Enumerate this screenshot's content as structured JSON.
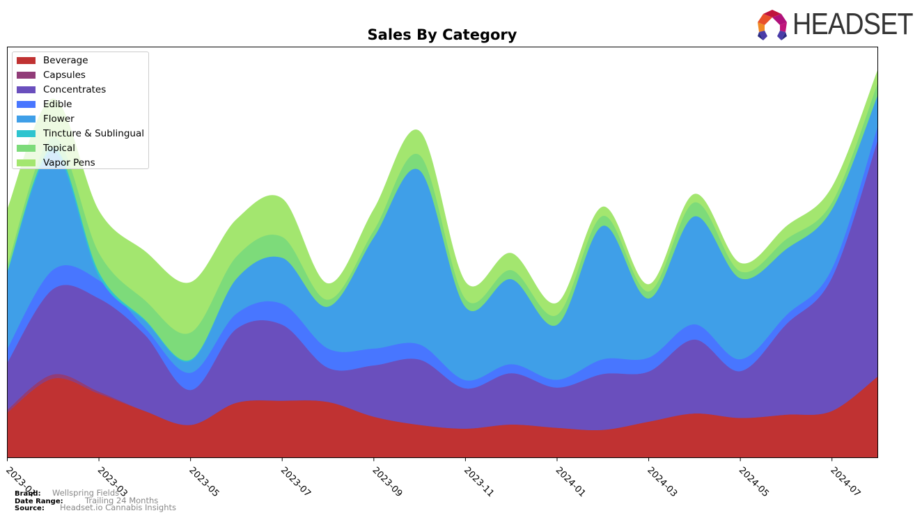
{
  "header": {
    "logo_text": "HEADSET",
    "logo_icon": "headset-hexagon-logo-icon"
  },
  "footer": {
    "brand_label": "Brand:",
    "brand_value": "Wellspring Fields",
    "date_range_label": "Date Range:",
    "date_range_value": "Trailing 24 Months",
    "source_label": "Source:",
    "source_value": "Headset.io Cannabis Insights"
  },
  "chart_data": {
    "type": "area",
    "stacked": true,
    "smoothed": true,
    "title": "Sales By Category",
    "xlabel": "",
    "ylabel": "",
    "y_units": "relative sales index (no y-axis scale shown)",
    "y_tick_labels_visible": false,
    "grid": false,
    "legend_position": "top-left",
    "x": [
      "2023-01",
      "2023-02",
      "2023-03",
      "2023-04",
      "2023-05",
      "2023-06",
      "2023-07",
      "2023-08",
      "2023-09",
      "2023-10",
      "2023-11",
      "2023-12",
      "2024-01",
      "2024-02",
      "2024-03",
      "2024-04",
      "2024-05",
      "2024-06",
      "2024-07",
      "2024-08"
    ],
    "x_tick_labels": [
      "2023-01",
      "2023-03",
      "2023-05",
      "2023-07",
      "2023-09",
      "2023-11",
      "2024-01",
      "2024-03",
      "2024-05",
      "2024-07"
    ],
    "ylim": [
      0,
      100
    ],
    "series": [
      {
        "name": "Beverage",
        "color": "#c03232",
        "values": [
          11.0,
          19.3,
          15.6,
          11.4,
          8.0,
          13.4,
          13.9,
          13.6,
          10.0,
          8.0,
          7.1,
          8.1,
          7.3,
          6.8,
          8.8,
          10.8,
          9.7,
          10.5,
          11.4,
          19.8
        ]
      },
      {
        "name": "Capsules",
        "color": "#913c78",
        "values": [
          0.7,
          1.0,
          0.5,
          0.0,
          0.0,
          0.0,
          0.0,
          0.0,
          0.0,
          0.0,
          0.0,
          0.0,
          0.0,
          0.0,
          0.0,
          0.0,
          0.0,
          0.0,
          0.0,
          0.0
        ]
      },
      {
        "name": "Concentrates",
        "color": "#6a4fbd",
        "values": [
          11.5,
          20.8,
          22.7,
          18.6,
          8.5,
          18.0,
          18.5,
          8.3,
          12.5,
          15.9,
          9.8,
          12.5,
          9.8,
          13.6,
          12.2,
          18.0,
          11.4,
          22.0,
          32.5,
          57.6
        ]
      },
      {
        "name": "Edible",
        "color": "#4876ff",
        "values": [
          3.4,
          4.7,
          4.4,
          1.7,
          4.2,
          3.7,
          5.1,
          4.7,
          4.1,
          3.7,
          2.0,
          2.2,
          1.9,
          3.6,
          3.4,
          3.7,
          2.9,
          2.2,
          2.2,
          3.4
        ]
      },
      {
        "name": "Flower",
        "color": "#3f9fe8",
        "values": [
          18.6,
          28.8,
          1.0,
          1.7,
          2.9,
          8.5,
          11.2,
          10.2,
          27.1,
          42.4,
          17.8,
          20.7,
          13.4,
          32.5,
          14.4,
          26.3,
          19.7,
          16.1,
          14.4,
          7.6
        ]
      },
      {
        "name": "Tincture & Sublingual",
        "color": "#2ec4cf",
        "values": [
          0.3,
          1.0,
          1.0,
          0.3,
          0.3,
          0.0,
          0.0,
          0.0,
          0.0,
          0.0,
          0.0,
          0.0,
          0.0,
          0.0,
          0.0,
          0.0,
          0.0,
          0.0,
          0.0,
          0.0
        ]
      },
      {
        "name": "Topical",
        "color": "#7ddb7a",
        "values": [
          1.4,
          2.5,
          4.7,
          4.7,
          6.6,
          5.4,
          5.1,
          1.7,
          1.7,
          3.7,
          2.0,
          2.2,
          2.4,
          2.4,
          1.7,
          3.4,
          1.7,
          2.4,
          1.7,
          2.9
        ]
      },
      {
        "name": "Vapor Pens",
        "color": "#a3e66f",
        "values": [
          13.6,
          9.3,
          10.2,
          11.9,
          12.2,
          9.0,
          9.3,
          3.9,
          5.1,
          5.8,
          4.1,
          4.1,
          2.9,
          2.2,
          1.7,
          2.0,
          2.0,
          3.1,
          3.7,
          3.1
        ]
      }
    ]
  }
}
